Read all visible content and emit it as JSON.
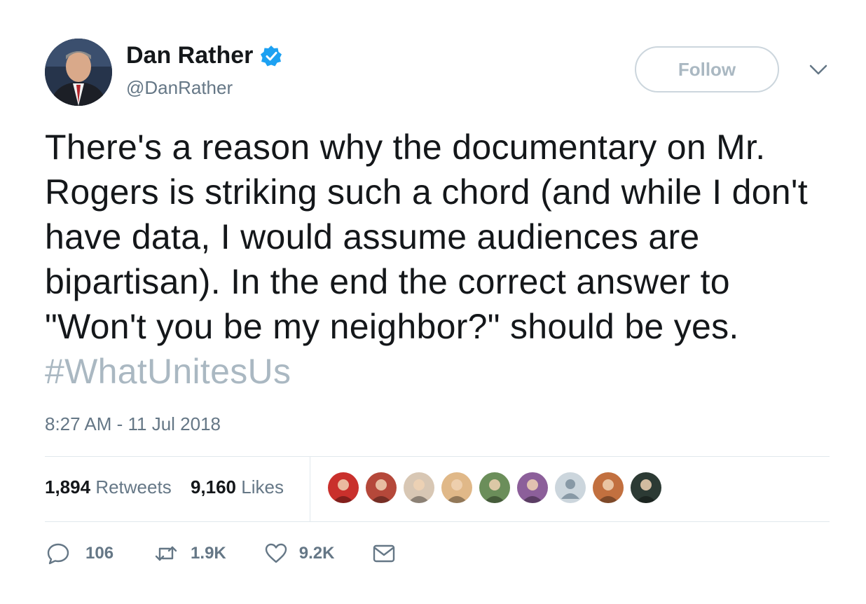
{
  "user": {
    "name": "Dan Rather",
    "handle": "@DanRather"
  },
  "follow_label": "Follow",
  "tweet": {
    "text": "There's a reason why the documentary on Mr. Rogers is striking such a chord (and while I don't have data, I would assume audiences are bipartisan). In the end the correct answer to \"Won't you be my neighbor?\" should be yes.",
    "hashtag": "#WhatUnitesUs",
    "timestamp": "8:27 AM - 11 Jul 2018"
  },
  "stats": {
    "retweets_count": "1,894",
    "retweets_label": "Retweets",
    "likes_count": "9,160",
    "likes_label": "Likes"
  },
  "likers": [
    {
      "color": "#c9302c"
    },
    {
      "color": "#b5483a"
    },
    {
      "color": "#d8c7b4"
    },
    {
      "color": "#e0b888"
    },
    {
      "color": "#6b8e5a"
    },
    {
      "color": "#8c5f9a"
    },
    {
      "color": "#ccd6dd"
    },
    {
      "color": "#c2703f"
    },
    {
      "color": "#2c3a34"
    }
  ],
  "actions": {
    "replies": "106",
    "retweets": "1.9K",
    "likes": "9.2K"
  },
  "icons": {
    "verified": "verified-badge-icon",
    "caret": "chevron-down-icon",
    "reply": "reply-icon",
    "retweet": "retweet-icon",
    "like": "heart-icon",
    "dm": "envelope-icon"
  },
  "colors": {
    "verified_blue": "#1da1f2",
    "secondary_text": "#657786",
    "hashtag": "#aab8c2"
  }
}
